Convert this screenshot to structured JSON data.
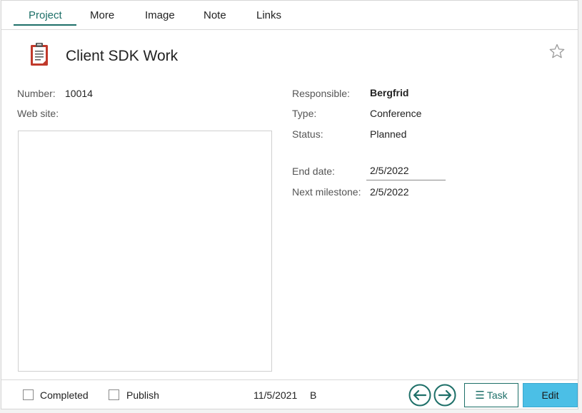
{
  "tabs": [
    {
      "label": "Project",
      "active": true
    },
    {
      "label": "More"
    },
    {
      "label": "Image"
    },
    {
      "label": "Note"
    },
    {
      "label": "Links"
    }
  ],
  "header": {
    "title": "Client SDK Work",
    "icon": "clipboard-icon",
    "favorite_icon": "star-icon"
  },
  "left_fields": {
    "number_label": "Number:",
    "number_value": "10014",
    "website_label": "Web site:",
    "website_value": ""
  },
  "right_fields": {
    "responsible_label": "Responsible:",
    "responsible_value": "Bergfrid",
    "type_label": "Type:",
    "type_value": "Conference",
    "status_label": "Status:",
    "status_value": "Planned",
    "end_date_label": "End date:",
    "end_date_value": "2/5/2022",
    "next_milestone_label": "Next milestone:",
    "next_milestone_value": "2/5/2022"
  },
  "footer": {
    "completed_label": "Completed",
    "completed_checked": false,
    "publish_label": "Publish",
    "publish_checked": false,
    "date": "11/5/2021",
    "user_initial": "B",
    "back_icon": "arrow-left-icon",
    "forward_icon": "arrow-right-icon",
    "task_label": "Task",
    "edit_label": "Edit"
  },
  "colors": {
    "accent": "#1d6f68",
    "edit_button": "#4bbfe6",
    "clipboard": "#c0392b"
  }
}
